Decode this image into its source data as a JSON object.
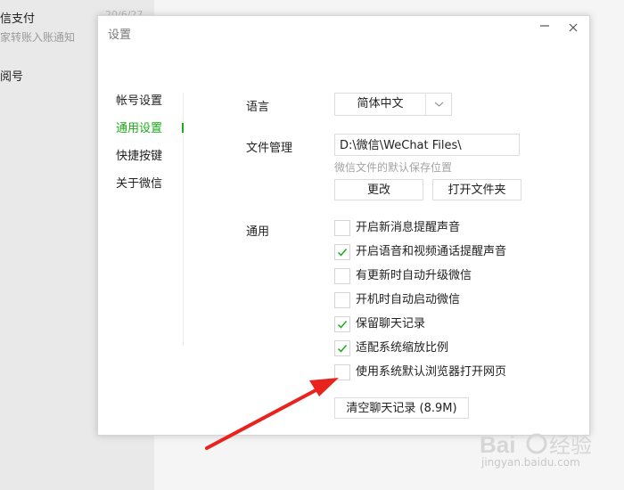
{
  "background": {
    "chat_title_1": "信支付",
    "chat_time_1": "20/6/27",
    "chat_preview_1": "家转账入账通知",
    "chat_title_2": "阅号"
  },
  "dialog": {
    "title": "设置",
    "minimize_icon": "minimize-icon",
    "close_icon": "close-icon"
  },
  "nav": {
    "items": [
      {
        "label": "帐号设置",
        "active": false
      },
      {
        "label": "通用设置",
        "active": true
      },
      {
        "label": "快捷按键",
        "active": false
      },
      {
        "label": "关于微信",
        "active": false
      }
    ]
  },
  "general": {
    "language_label": "语言",
    "language_value": "简体中文",
    "file_label": "文件管理",
    "file_path": "D:\\微信\\WeChat Files\\",
    "file_hint": "微信文件的默认保存位置",
    "change_button": "更改",
    "open_folder_button": "打开文件夹",
    "general_label": "通用",
    "options": [
      {
        "label": "开启新消息提醒声音",
        "checked": false
      },
      {
        "label": "开启语音和视频通话提醒声音",
        "checked": true
      },
      {
        "label": "有更新时自动升级微信",
        "checked": false
      },
      {
        "label": "开机时自动启动微信",
        "checked": false
      },
      {
        "label": "保留聊天记录",
        "checked": true
      },
      {
        "label": "适配系统缩放比例",
        "checked": true
      },
      {
        "label": "使用系统默认浏览器打开网页",
        "checked": false
      }
    ],
    "clear_button": "清空聊天记录 (8.9M)"
  },
  "colors": {
    "accent": "#1aad19",
    "arrow": "#e8231d"
  },
  "watermark": {
    "text": "jingyan.baidu.com"
  }
}
